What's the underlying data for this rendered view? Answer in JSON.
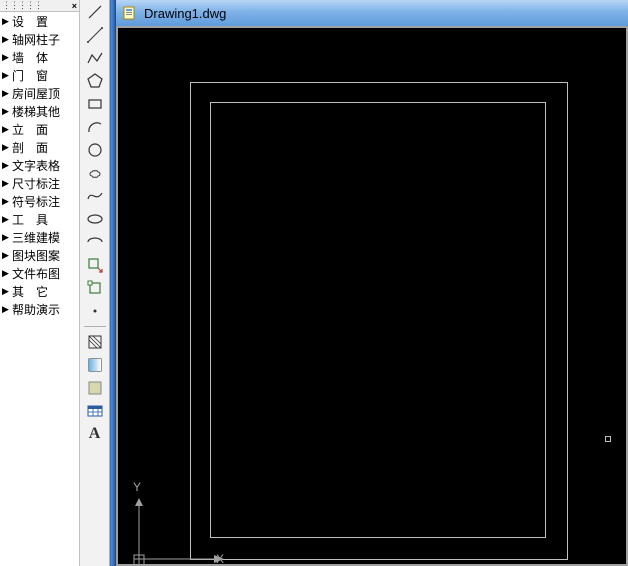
{
  "sidebar": {
    "items": [
      {
        "label": "设　置"
      },
      {
        "label": "轴网柱子"
      },
      {
        "label": "墙　体"
      },
      {
        "label": "门　窗"
      },
      {
        "label": "房间屋顶"
      },
      {
        "label": "楼梯其他"
      },
      {
        "label": "立　面"
      },
      {
        "label": "剖　面"
      },
      {
        "label": "文字表格"
      },
      {
        "label": "尺寸标注"
      },
      {
        "label": "符号标注"
      },
      {
        "label": "工　具"
      },
      {
        "label": "三维建模"
      },
      {
        "label": "图块图案"
      },
      {
        "label": "文件布图"
      },
      {
        "label": "其　它"
      },
      {
        "label": "帮助演示"
      }
    ]
  },
  "tools": {
    "names": [
      "line",
      "construction-line",
      "polyline",
      "polygon",
      "rectangle",
      "arc",
      "circle",
      "revision-cloud",
      "spline",
      "ellipse",
      "ellipse-arc",
      "insert-block",
      "make-block",
      "point",
      "hatch",
      "gradient",
      "region",
      "table",
      "text"
    ]
  },
  "document": {
    "title": "Drawing1.dwg"
  },
  "axes": {
    "y_label": "Y",
    "x_label": "X"
  }
}
